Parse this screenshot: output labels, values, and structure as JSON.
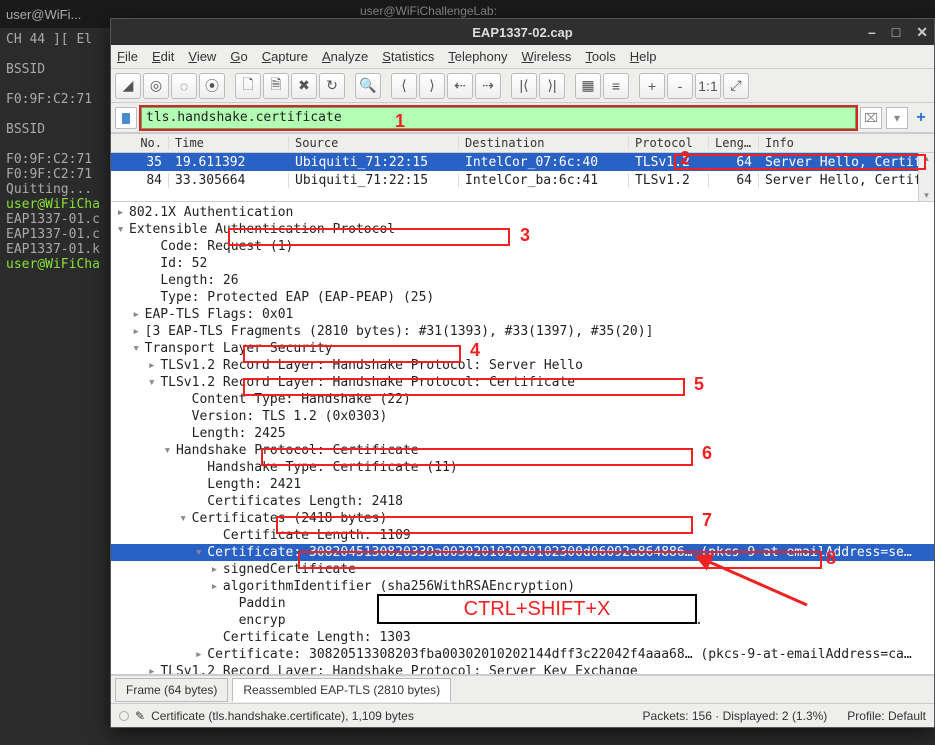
{
  "terminal": {
    "tab_label": "user@WiFi...",
    "lines": [
      {
        "cls": "gray",
        "text": "CH 44 ][ El"
      },
      {
        "cls": "",
        "text": ""
      },
      {
        "cls": "gray",
        "text": "BSSID"
      },
      {
        "cls": "",
        "text": ""
      },
      {
        "cls": "gray",
        "text": "F0:9F:C2:71"
      },
      {
        "cls": "",
        "text": ""
      },
      {
        "cls": "gray",
        "text": "BSSID"
      },
      {
        "cls": "",
        "text": ""
      },
      {
        "cls": "gray",
        "text": "F0:9F:C2:71"
      },
      {
        "cls": "gray",
        "text": "F0:9F:C2:71"
      },
      {
        "cls": "gray",
        "text": "Quitting..."
      },
      {
        "cls": "green",
        "text": "user@WiFiCha"
      },
      {
        "cls": "gray",
        "text": "EAP1337-01.c"
      },
      {
        "cls": "gray",
        "text": "EAP1337-01.c"
      },
      {
        "cls": "gray",
        "text": "EAP1337-01.k"
      },
      {
        "cls": "green",
        "text": "user@WiFiCha"
      }
    ]
  },
  "bg_title": "user@WiFiChallengeLab:",
  "ws": {
    "title": "EAP1337-02.cap",
    "winbtns": {
      "min": "–",
      "max": "□",
      "close": "✕"
    },
    "menu": [
      "File",
      "Edit",
      "View",
      "Go",
      "Capture",
      "Analyze",
      "Statistics",
      "Telephony",
      "Wireless",
      "Tools",
      "Help"
    ],
    "toolbar_icons": [
      "◢",
      "◎",
      "◌",
      "⦿",
      "🗋",
      "🗎",
      "✖",
      "↻",
      "🔍",
      "⟨",
      "⟩",
      "⇠",
      "⇢",
      "|⟨",
      "⟩|",
      "▦",
      "≡",
      "+",
      "-",
      "1:1",
      "⤢"
    ],
    "filter": {
      "value": "tls.handshake.certificate",
      "clear": "⌧",
      "dropdown": "▾",
      "plus": "+",
      "icon_label": "filter-bookmark-icon"
    },
    "cols": {
      "no": "No.",
      "time": "Time",
      "src": "Source",
      "dst": "Destination",
      "proto": "Protocol",
      "len": "Length",
      "info": "Info"
    },
    "rows": [
      {
        "no": "35",
        "time": "19.611392",
        "src": "Ubiquiti_71:22:15",
        "dst": "IntelCor_07:6c:40",
        "proto": "TLSv1.2",
        "len": "64",
        "info": "Server Hello, Certificate,",
        "sel": true
      },
      {
        "no": "84",
        "time": "33.305664",
        "src": "Ubiquiti_71:22:15",
        "dst": "IntelCor_ba:6c:41",
        "proto": "TLSv1.2",
        "len": "64",
        "info": "Server Hello, Certificate,",
        "sel": false
      }
    ],
    "tree": [
      {
        "ind": 0,
        "t": "▸",
        "txt": "802.1X Authentication"
      },
      {
        "ind": 0,
        "t": "▾",
        "txt": "Extensible Authentication Protocol"
      },
      {
        "ind": 2,
        "t": " ",
        "txt": "Code: Request (1)"
      },
      {
        "ind": 2,
        "t": " ",
        "txt": "Id: 52"
      },
      {
        "ind": 2,
        "t": " ",
        "txt": "Length: 26"
      },
      {
        "ind": 2,
        "t": " ",
        "txt": "Type: Protected EAP (EAP-PEAP) (25)"
      },
      {
        "ind": 1,
        "t": "▸",
        "txt": "EAP-TLS Flags: 0x01"
      },
      {
        "ind": 1,
        "t": "▸",
        "txt": "[3 EAP-TLS Fragments (2810 bytes): #31(1393), #33(1397), #35(20)]"
      },
      {
        "ind": 1,
        "t": "▾",
        "txt": "Transport Layer Security"
      },
      {
        "ind": 2,
        "t": "▸",
        "txt": "TLSv1.2 Record Layer: Handshake Protocol: Server Hello"
      },
      {
        "ind": 2,
        "t": "▾",
        "txt": "TLSv1.2 Record Layer: Handshake Protocol: Certificate"
      },
      {
        "ind": 4,
        "t": " ",
        "txt": "Content Type: Handshake (22)"
      },
      {
        "ind": 4,
        "t": " ",
        "txt": "Version: TLS 1.2 (0x0303)"
      },
      {
        "ind": 4,
        "t": " ",
        "txt": "Length: 2425"
      },
      {
        "ind": 3,
        "t": "▾",
        "txt": "Handshake Protocol: Certificate"
      },
      {
        "ind": 5,
        "t": " ",
        "txt": "Handshake Type: Certificate (11)"
      },
      {
        "ind": 5,
        "t": " ",
        "txt": "Length: 2421"
      },
      {
        "ind": 5,
        "t": " ",
        "txt": "Certificates Length: 2418"
      },
      {
        "ind": 4,
        "t": "▾",
        "txt": "Certificates (2418 bytes)"
      },
      {
        "ind": 6,
        "t": " ",
        "txt": "Certificate Length: 1109"
      },
      {
        "ind": 5,
        "t": "▾",
        "txt": "Certificate: 3082045130820339a003020102020102300d06092a864886… (pkcs-9-at-emailAddress=se…",
        "sel": true
      },
      {
        "ind": 6,
        "t": "▸",
        "txt": "signedCertificate"
      },
      {
        "ind": 6,
        "t": "▸",
        "txt": "algorithmIdentifier (sha256WithRSAEncryption)"
      },
      {
        "ind": 7,
        "t": " ",
        "txt": "Paddin"
      },
      {
        "ind": 7,
        "t": " ",
        "txt": "encryp                                        3d71da8c1c57…"
      },
      {
        "ind": 6,
        "t": " ",
        "txt": "Certificate Length: 1303"
      },
      {
        "ind": 5,
        "t": "▸",
        "txt": "Certificate: 30820513308203fba00302010202144dff3c22042f4aaa68… (pkcs-9-at-emailAddress=ca…"
      },
      {
        "ind": 2,
        "t": "▸",
        "txt": "TLSv1.2 Record Layer: Handshake Protocol: Server Key Exchange"
      },
      {
        "ind": 2,
        "t": "▸",
        "txt": "TLSv1.2 Record Layer: Handshake Protocol: Server Hello Done"
      }
    ],
    "tabs": {
      "frame": "Frame (64 bytes)",
      "reasm": "Reassembled EAP-TLS (2810 bytes)"
    },
    "status": {
      "field": "Certificate (tls.handshake.certificate), 1,109 bytes",
      "pkts": "Packets: 156 · Displayed: 2 (1.3%)",
      "profile": "Profile: Default"
    }
  },
  "annotations": {
    "ctrlshiftx": "CTRL+SHIFT+X",
    "nums": {
      "n1": "1",
      "n2": "2",
      "n3": "3",
      "n4": "4",
      "n5": "5",
      "n6": "6",
      "n7": "7",
      "n8": "8"
    }
  }
}
